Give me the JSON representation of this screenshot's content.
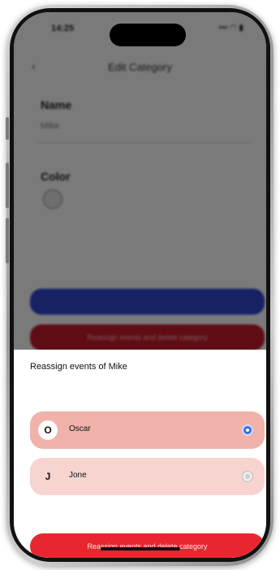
{
  "status_bar": {
    "time": "14:25",
    "icons": "••• ◠ ▮"
  },
  "background_screen": {
    "title": "Edit Category",
    "back_label": "‹",
    "name_label": "Name",
    "name_value": "Mike",
    "color_label": "Color",
    "secondary_button_label": "Reassign events and delete category"
  },
  "sheet": {
    "title": "Reassign events of Mike",
    "options": [
      {
        "initial": "O",
        "label": "Oscar",
        "selected": true
      },
      {
        "initial": "J",
        "label": "Jone",
        "selected": false
      }
    ],
    "primary_button_label": "Reassign events and delete category"
  },
  "colors": {
    "accent_red": "#e8262f",
    "selected_option": "#f0b2ab",
    "unselected_option": "#f8d4d0",
    "radio_selected": "#3d6fe0",
    "background_blue_button": "#2e43c9"
  },
  "icons": {
    "radio_selected": "radio-selected-icon",
    "radio_unselected": "radio-unselected-icon"
  }
}
